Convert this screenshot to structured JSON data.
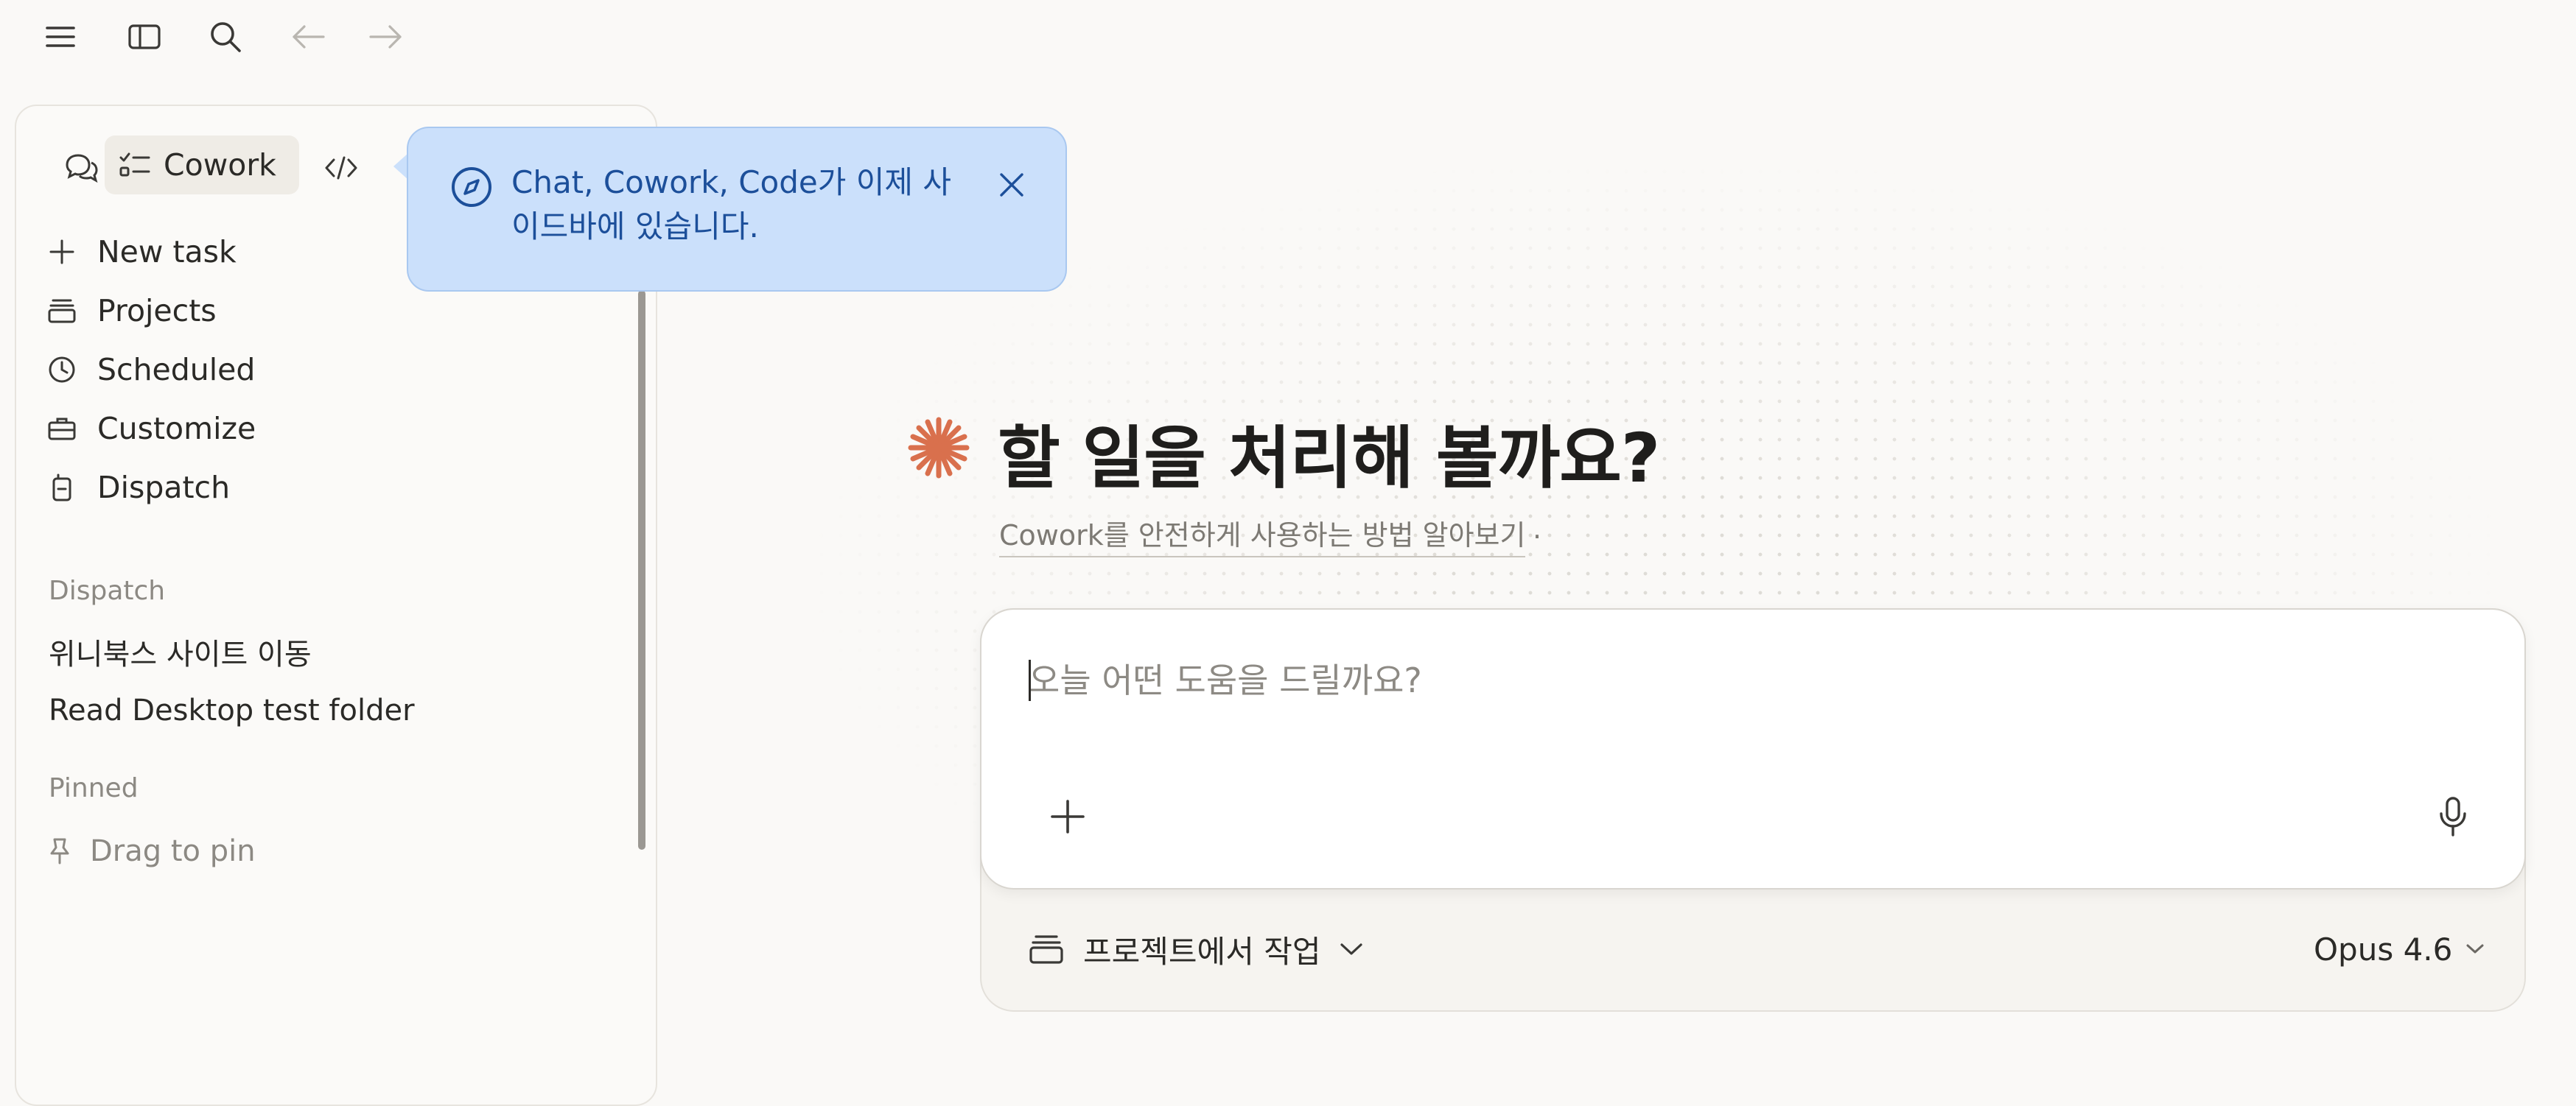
{
  "toolbar": {
    "icons": [
      "menu-icon",
      "sidebar-toggle-icon",
      "search-icon",
      "arrow-left-icon",
      "arrow-right-icon"
    ]
  },
  "sidebar": {
    "modes": [
      {
        "name": "chat",
        "icon": "chat-bubbles-icon"
      },
      {
        "name": "cowork",
        "label": "Cowork",
        "icon": "checklist-icon",
        "selected": true
      },
      {
        "name": "code",
        "icon": "code-icon"
      }
    ],
    "nav": [
      {
        "label": "New task",
        "icon": "plus-icon"
      },
      {
        "label": "Projects",
        "icon": "folder-stack-icon"
      },
      {
        "label": "Scheduled",
        "icon": "clock-icon"
      },
      {
        "label": "Customize",
        "icon": "briefcase-icon"
      },
      {
        "label": "Dispatch",
        "icon": "phone-icon"
      }
    ],
    "dispatch_section": {
      "title": "Dispatch",
      "items": [
        "위니북스 사이트 이동",
        "Read Desktop test folder"
      ]
    },
    "pinned_section": {
      "title": "Pinned",
      "hint": "Drag to pin"
    }
  },
  "tooltip": {
    "text": "Chat, Cowork, Code가 이제 사이드바에 있습니다.",
    "icon": "compass-icon",
    "bg_color": "#cbe0fb",
    "text_color": "#1c4f9a"
  },
  "main": {
    "heading": "할 일을 처리해 볼까요?",
    "learn_link": "Cowork를 안전하게 사용하는 방법 알아보기",
    "learn_suffix": ".",
    "logo_color": "#d9704d",
    "composer": {
      "placeholder": "오늘 어떤 도움을 드릴까요?",
      "value": ""
    },
    "project_selector": "프로젝트에서 작업",
    "model_selector": "Opus 4.6"
  }
}
